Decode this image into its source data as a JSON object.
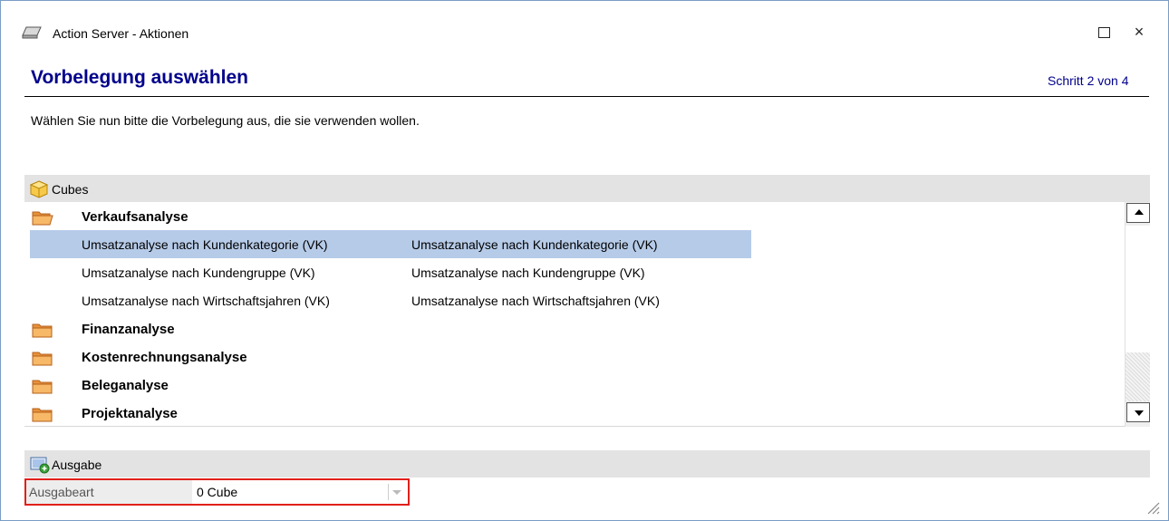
{
  "window": {
    "title": "Action Server - Aktionen",
    "maximize_symbol": "",
    "close_symbol": "×"
  },
  "header": {
    "title": "Vorbelegung auswählen",
    "step": "Schritt 2 von 4"
  },
  "instructions": "Wählen Sie nun bitte die Vorbelegung aus, die sie verwenden wollen.",
  "cubes": {
    "section_label": "Cubes",
    "groups": [
      {
        "label": "Verkaufsanalyse",
        "expanded": true,
        "items": [
          {
            "col1": "Umsatzanalyse nach Kundenkategorie (VK)",
            "col2": "Umsatzanalyse nach Kundenkategorie (VK)",
            "selected": true
          },
          {
            "col1": "Umsatzanalyse nach Kundengruppe (VK)",
            "col2": "Umsatzanalyse nach Kundengruppe (VK)",
            "selected": false
          },
          {
            "col1": "Umsatzanalyse nach Wirtschaftsjahren (VK)",
            "col2": "Umsatzanalyse nach Wirtschaftsjahren (VK)",
            "selected": false
          }
        ]
      },
      {
        "label": "Finanzanalyse",
        "expanded": false
      },
      {
        "label": "Kostenrechnungsanalyse",
        "expanded": false
      },
      {
        "label": "Beleganalyse",
        "expanded": false
      },
      {
        "label": "Projektanalyse",
        "expanded": false
      }
    ]
  },
  "ausgabe": {
    "section_label": "Ausgabe",
    "field_label": "Ausgabeart",
    "field_value": "0 Cube"
  },
  "colors": {
    "title_blue": "#00008b",
    "selection": "#b6cbe8",
    "highlight_border": "#e0201a"
  },
  "icons": {
    "app": "eraser-icon",
    "cubes": "cube-icon",
    "folder": "folder-icon",
    "ausgabe": "output-icon"
  }
}
